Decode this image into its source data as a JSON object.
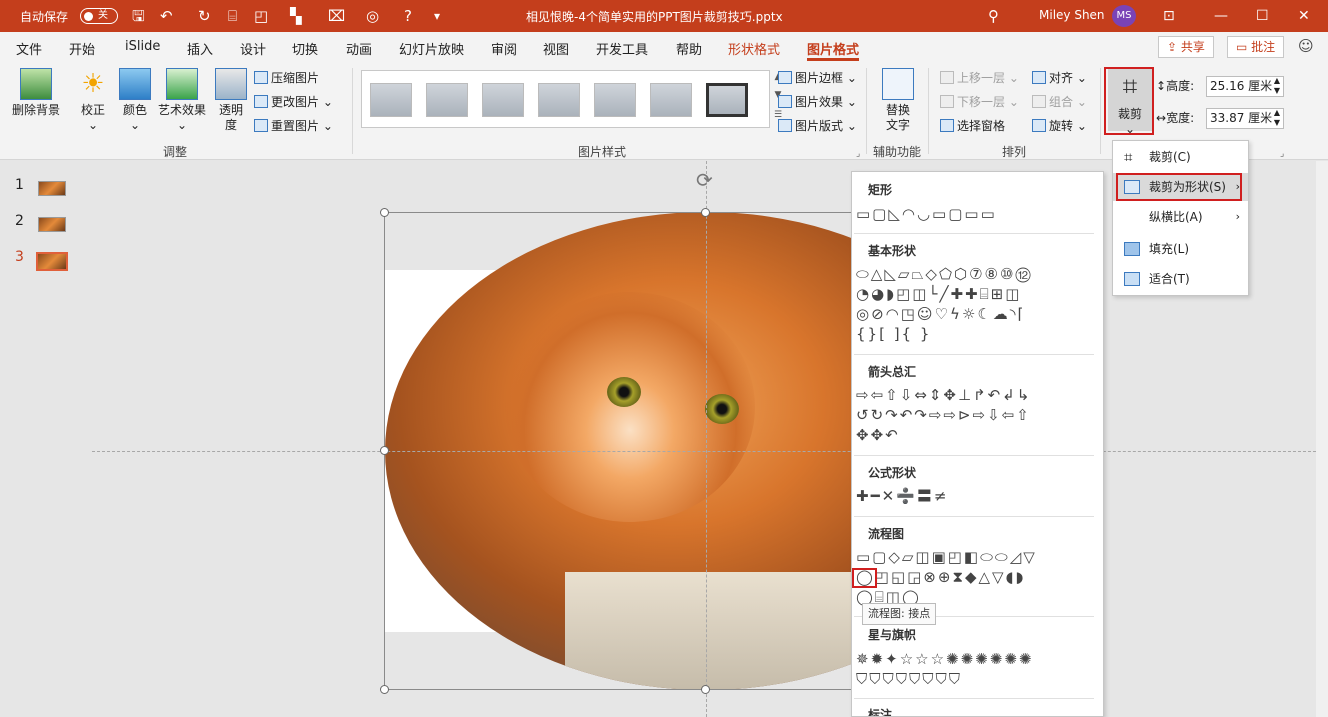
{
  "titlebar": {
    "autosave_label": "自动保存",
    "autosave_state": "关",
    "doc_title": "相见恨晚-4个简单实用的PPT图片裁剪技巧.pptx",
    "user_name": "Miley Shen",
    "user_initials": "MS",
    "bg_color": "#c43e1c"
  },
  "tabs": [
    "文件",
    "开始",
    "iSlide",
    "插入",
    "设计",
    "切换",
    "动画",
    "幻灯片放映",
    "审阅",
    "视图",
    "开发工具",
    "帮助",
    "形状格式",
    "图片格式"
  ],
  "share_label": "共享",
  "comment_label": "批注",
  "ribbon": {
    "remove_bg": "删除背景",
    "corrections": "校正",
    "color": "颜色",
    "artistic": "艺术效果",
    "transparency": "透明\n度",
    "compress": "压缩图片",
    "change_pic": "更改图片",
    "reset_pic": "重置图片",
    "group_adjust": "调整",
    "pic_border": "图片边框",
    "pic_effects": "图片效果",
    "pic_layout": "图片版式",
    "group_styles": "图片样式",
    "alt_text": "替换\n文字",
    "group_access": "辅助功能",
    "bring_forward": "上移一层",
    "send_backward": "下移一层",
    "selection_pane": "选择窗格",
    "align": "对齐",
    "group": "组合",
    "rotate": "旋转",
    "group_arrange": "排列",
    "crop": "裁剪",
    "height_label": "高度:",
    "height_value": "25.16 厘米",
    "width_label": "宽度:",
    "width_value": "33.87 厘米"
  },
  "slides": [
    "1",
    "2",
    "3"
  ],
  "active_slide": "3",
  "shape_menu": {
    "sec_rect": "矩形",
    "rect_row": "▭▢◺◠◡▭▢▭▭",
    "sec_basic": "基本形状",
    "basic_r1": "⬭△◺▱⏢◇⬠⬡⑦⑧⑩⑫",
    "basic_r2": "◔◕◗◰◫└╱✚✚⌸⊞◫",
    "basic_r3": "◎⊘◠◳☺♡ϟ☼☾☁◝⌈",
    "basic_r4": "{}[ ]{ }",
    "sec_arrow": "箭头总汇",
    "arrow_r1": "⇨⇦⇧⇩⇔⇕✥⊥↱↶↲↳",
    "arrow_r2": "↺↻↷↶↷⇨⇨⊳⇨⇩⇦⇧",
    "arrow_r3": "✥✥↶",
    "sec_eq": "公式形状",
    "eq_row": "✚━✕➗〓≠",
    "sec_flow": "流程图",
    "flow_r1": "▭▢◇▱◫▣◰◧⬭⬭◿▽",
    "flow_r2": "◯◰◱◲⊗⊕⧗◆△▽◖◗",
    "flow_r3": "◯⌸◫◯",
    "tooltip": "流程图: 接点",
    "sec_star": "星与旗帜",
    "star_r1": "✵✹✦☆☆☆✺✺✺✺✺✺",
    "star_r2": "⛉⛉⛉⛉⛉⛉⛉⛉",
    "sec_callout": "标注"
  },
  "crop_menu": {
    "crop": "裁剪(C)",
    "crop_to_shape": "裁剪为形状(S)",
    "aspect": "纵横比(A)",
    "fill": "填充(L)",
    "fit": "适合(T)"
  }
}
